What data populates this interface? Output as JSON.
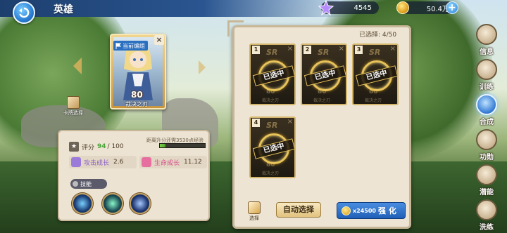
{
  "topbar": {
    "title": "英雄",
    "gem_value": "4545",
    "gold_value": "50.4万"
  },
  "hero_card": {
    "tag": "当前编组",
    "power": "80",
    "name": "裁决之刃",
    "card_select_label": "卡牌选择"
  },
  "stats": {
    "rating_label": "评分",
    "rating_value": "94",
    "rating_max": "/ 100",
    "upgrade_hint": "距离升分还需3530点经验",
    "exp_progress": 0.12,
    "attack_growth_label": "攻击成长",
    "attack_growth_value": "2.6",
    "hp_growth_label": "生命成长",
    "hp_growth_value": "11.12",
    "skills_label": "技能"
  },
  "selection": {
    "count_text": "已选择: 4/50",
    "slots": [
      {
        "num": "1",
        "stamp": "已选中",
        "rarity": "SR",
        "power": "80",
        "name": "裁决之刃"
      },
      {
        "num": "2",
        "stamp": "已选中",
        "rarity": "SR",
        "power": "80",
        "name": "裁决之刃"
      },
      {
        "num": "3",
        "stamp": "已选中",
        "rarity": "SR",
        "power": "80",
        "name": "裁决之刃"
      },
      {
        "num": "4",
        "stamp": "已选中",
        "rarity": "SR",
        "power": "80",
        "name": "裁决之刃"
      }
    ],
    "select_label": "选择",
    "auto_select_label": "自动选择",
    "enhance_cost": "x24500",
    "enhance_label": "强 化"
  },
  "side_menu": [
    {
      "label": "信息",
      "icon": "info-icon",
      "active": false
    },
    {
      "label": "训练",
      "icon": "training-icon",
      "active": false
    },
    {
      "label": "合成",
      "icon": "compose-icon",
      "active": true
    },
    {
      "label": "功勋",
      "icon": "merit-icon",
      "active": false
    },
    {
      "label": "潜能",
      "icon": "potential-icon",
      "active": false
    },
    {
      "label": "洗练",
      "icon": "refine-icon",
      "active": false
    }
  ],
  "colors": {
    "accent_blue": "#2a7fd6",
    "gold": "#d8b25d",
    "panel": "#ede4d3",
    "growth_green": "#4aa337"
  }
}
